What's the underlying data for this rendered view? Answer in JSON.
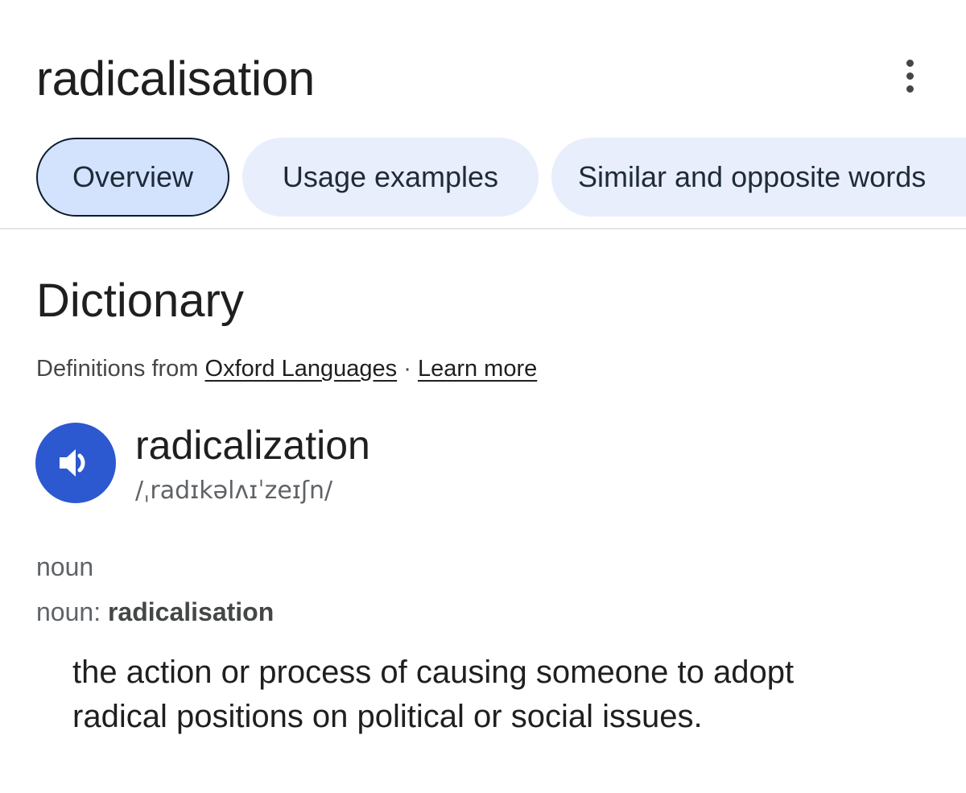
{
  "header": {
    "title": "radicalisation",
    "more_icon": "more-vert-icon"
  },
  "tabs": [
    {
      "label": "Overview",
      "active": true
    },
    {
      "label": "Usage examples",
      "active": false
    },
    {
      "label": "Similar and opposite words",
      "active": false
    }
  ],
  "dictionary": {
    "section_title": "Dictionary",
    "source_prefix": "Definitions from",
    "source_link": "Oxford Languages",
    "separator": "·",
    "learn_more": "Learn more",
    "audio_icon": "speaker-icon",
    "headword": "radicalization",
    "phonetic": "/ˌradɪkəlʌɪˈzeɪʃn/",
    "part_of_speech": "noun",
    "pos_label": "noun:",
    "pos_variant": "radicalisation",
    "definition": "the action or process of causing someone to adopt radical positions on political or social issues."
  },
  "colors": {
    "accent_blue": "#2c58d0",
    "chip_bg": "#e8eefb",
    "chip_active_bg": "#d3e3fd",
    "chip_active_border": "#0b1b2e"
  }
}
